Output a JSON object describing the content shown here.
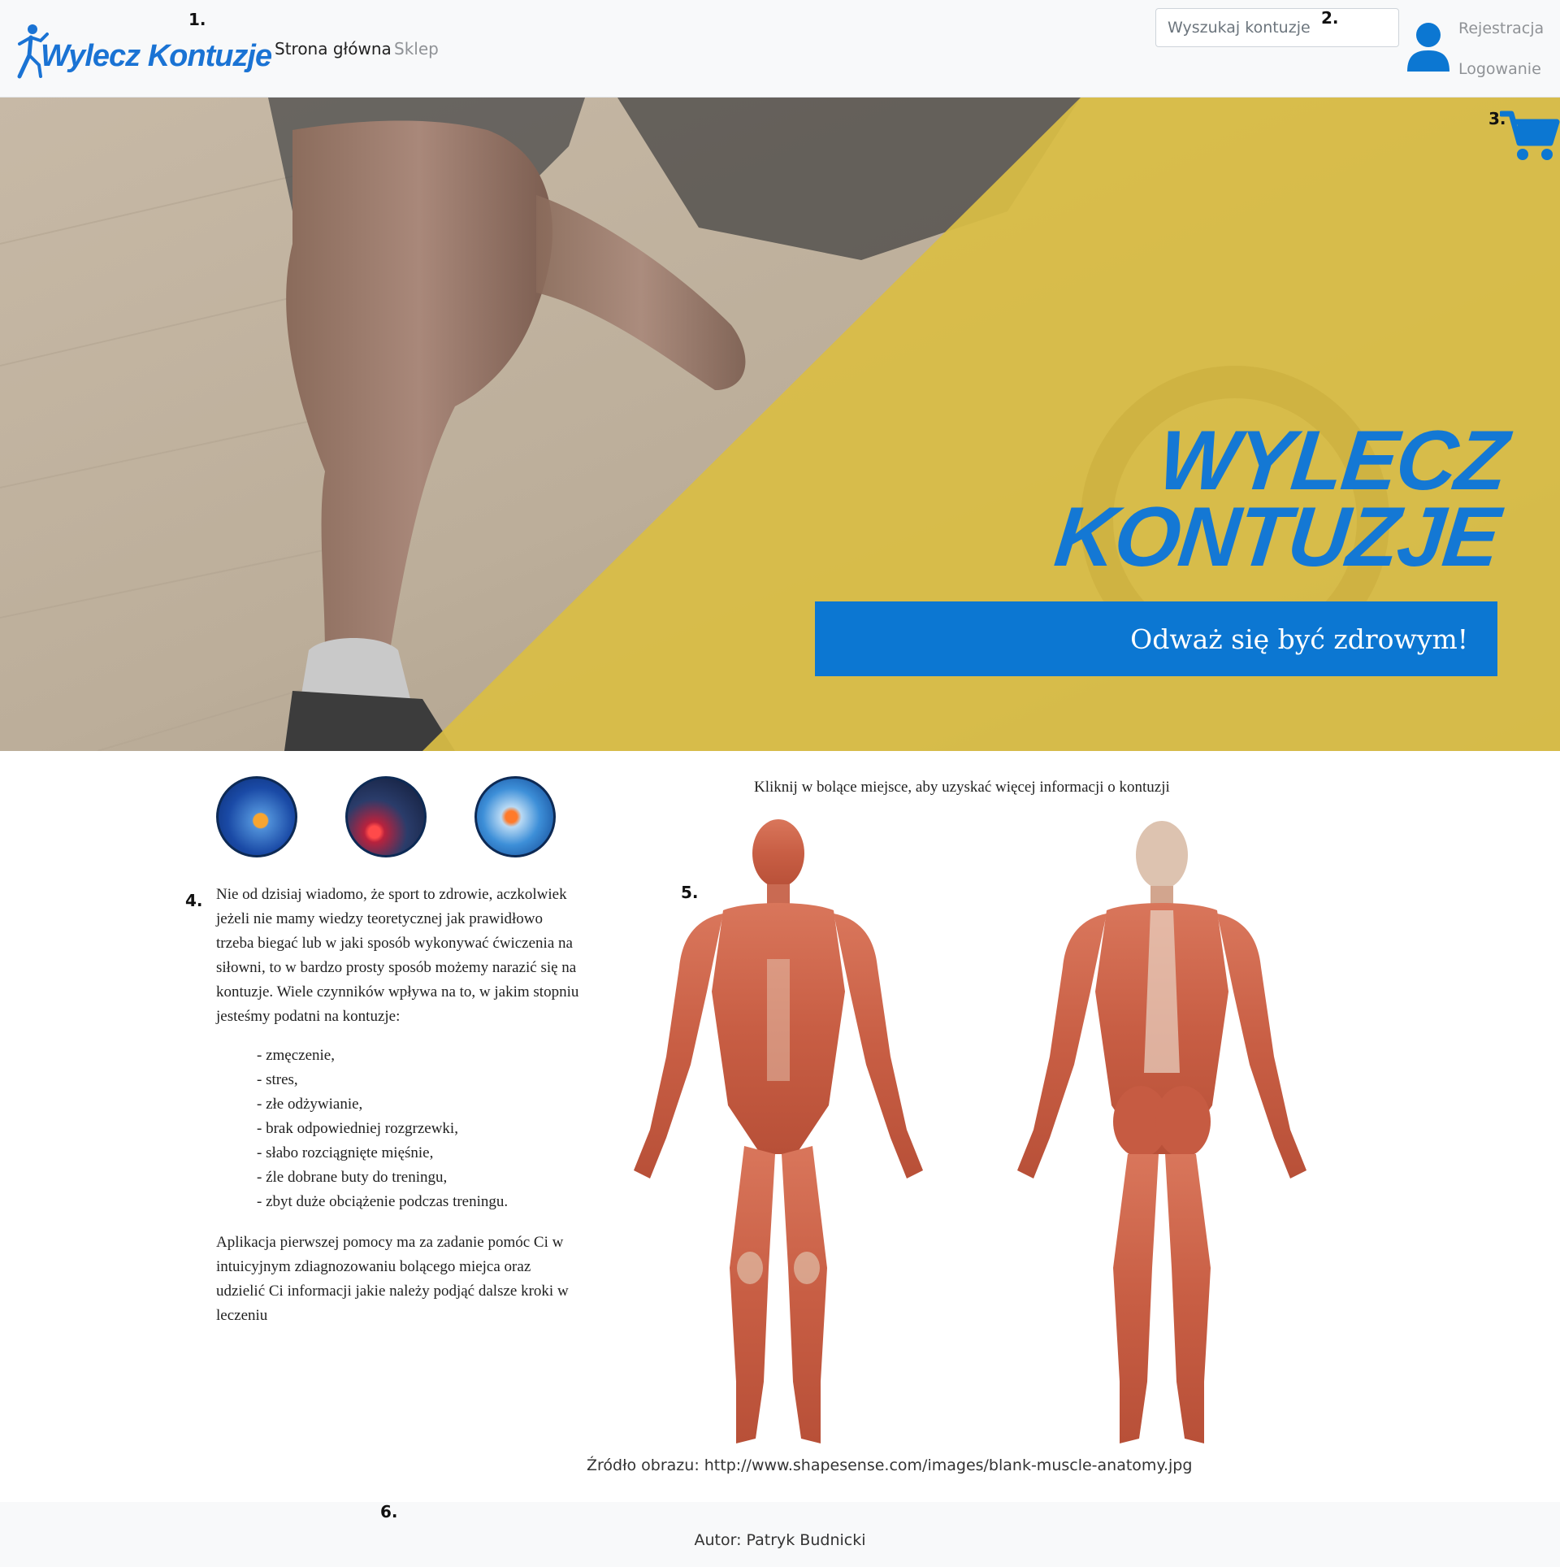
{
  "header": {
    "logo_text": "Wylecz Kontuzje",
    "nav": {
      "home": "Strona główna",
      "shop": "Sklep"
    },
    "search_placeholder": "Wyszukaj kontuzje",
    "auth": {
      "register": "Rejestracja",
      "login": "Logowanie"
    },
    "icons": {
      "user": "user-icon",
      "cart": "cart-icon"
    }
  },
  "hero": {
    "title_line1": "WYLECZ",
    "title_line2": "KONTUZJE",
    "cta": "Odważ się być zdrowym!"
  },
  "markers": [
    "1.",
    "2.",
    "3.",
    "4.",
    "5.",
    "6."
  ],
  "content": {
    "injury_icons": [
      "ankle-injury-icon",
      "back-injury-icon",
      "knee-injury-icon"
    ],
    "intro": "Nie od dzisiaj wiadomo, że sport to zdrowie, aczkolwiek jeżeli nie mamy wiedzy teoretycznej jak prawidłowo trzeba biegać lub w jaki sposób wykonywać ćwiczenia na siłowni, to w bardzo prosty sposób możemy narazić się na kontuzje. Wiele czynników wpływa na to, w jakim stopniu jesteśmy podatni na kontuzje:",
    "factors": [
      "- zmęczenie,",
      "- stres,",
      "- złe odżywianie,",
      "- brak odpowiedniej rozgrzewki,",
      "- słabo rozciągnięte mięśnie,",
      "- źle dobrane buty do treningu,",
      "- zbyt duże obciążenie podczas treningu."
    ],
    "outro": "Aplikacja pierwszej pomocy ma za zadanie pomóc Ci w intuicyjnym zdiagnozowaniu bolącego miejca oraz udzielić Ci informacji jakie należy podjąć dalsze kroki w leczeniu",
    "map_caption": "Kliknij w bolące miejsce, aby uzyskać więcej informacji o kontuzji",
    "image_source": "Źródło obrazu: http://www.shapesense.com/images/blank-muscle-anatomy.jpg"
  },
  "footer": {
    "author": "Autor: Patryk Budnicki"
  },
  "colors": {
    "brand_blue": "#0c77d2",
    "hero_yellow": "#d9bd45",
    "navbar_bg": "#f8f9fa"
  }
}
